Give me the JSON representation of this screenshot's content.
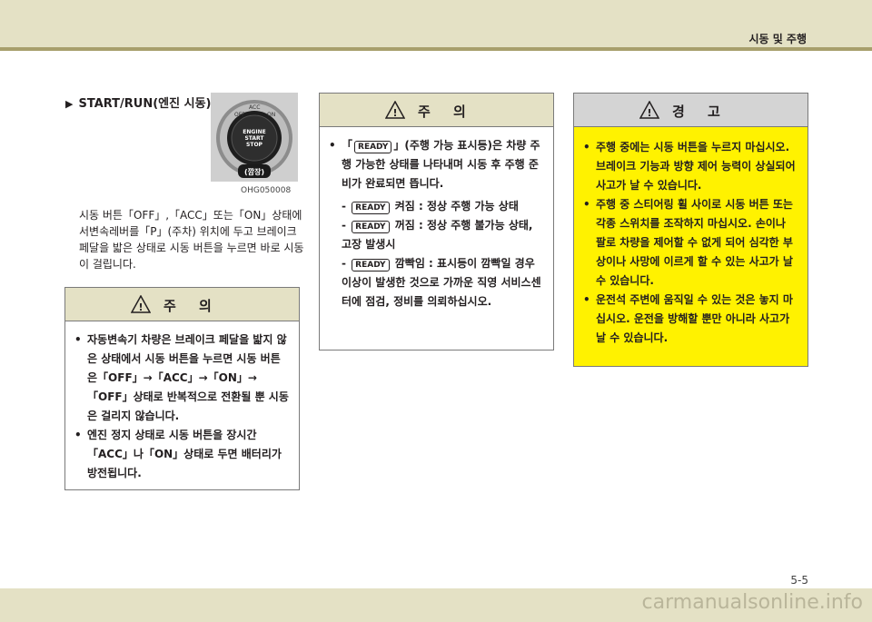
{
  "header": {
    "section_title": "시동 및 주행"
  },
  "heading": {
    "title": "START/RUN(엔진 시동)"
  },
  "photo": {
    "caption": "OHG050008",
    "button_lines": [
      "ENGINE",
      "START",
      "STOP"
    ],
    "ring_labels": [
      "OFF",
      "ACC",
      "ON"
    ],
    "tag": "(깜장)"
  },
  "body": {
    "paragraph": "시동 버튼「OFF」,「ACC」또는「ON」상태에 서변속레버를「P」(주차) 위치에 두고 브레이크 페달을 밟은 상태로 시동 버튼을 누르면 바로 시동이 걸립니다."
  },
  "caution1": {
    "title": "주 의",
    "items": [
      "자동변속기 차량은 브레이크 페달을 밟지 않은 상태에서 시동 버튼을 누르면 시동 버튼은「OFF」→「ACC」→「ON」→「OFF」상태로 반복적으로 전환될 뿐 시동은 걸리지 않습니다.",
      "엔진 정지 상태로 시동 버튼을 장시간「ACC」나「ON」상태로 두면 배터리가 방전됩니다."
    ]
  },
  "caution2": {
    "title": "주 의",
    "intro_before": "「",
    "intro_after": "」(주행 가능 표시등)은 차량 주행 가능한 상태를 나타내며 시동 후 주행 준비가 완료되면 뜹니다.",
    "ready_label": "READY",
    "states": [
      {
        "dash": "-",
        "label": "켜짐 :",
        "desc": "정상 주행 가능 상태"
      },
      {
        "dash": "-",
        "label": "꺼짐 :",
        "desc": "정상 주행 불가능 상태, 고장 발생시"
      },
      {
        "dash": "-",
        "label": "깜빡임 :",
        "desc": "표시등이 깜빡일 경우 이상이 발생한 것으로 가까운 직영 서비스센터에 점검, 정비를 의뢰하십시오."
      }
    ]
  },
  "warning": {
    "title": "경 고",
    "items": [
      "주행 중에는 시동 버튼을 누르지 마십시오. 브레이크 기능과 방향 제어 능력이 상실되어 사고가 날 수 있습니다.",
      "주행 중 스티어링 휠 사이로 시동 버튼 또는 각종 스위치를 조작하지 마십시오. 손이나 팔로 차량을 제어할 수 없게 되어 심각한 부상이나 사망에 이르게 할 수 있는 사고가 날 수 있습니다.",
      "운전석 주변에 움직일 수 있는 것은 놓지 마십시오. 운전을 방해할 뿐만 아니라 사고가 날 수 있습니다."
    ]
  },
  "footer": {
    "page_number": "5-5",
    "watermark": "carmanualsonline.info"
  },
  "colors": {
    "header_bg": "#e4e1c5",
    "header_rule": "#a79f6c",
    "warning_bg": "#fff200",
    "warning_head": "#d4d4d4"
  }
}
